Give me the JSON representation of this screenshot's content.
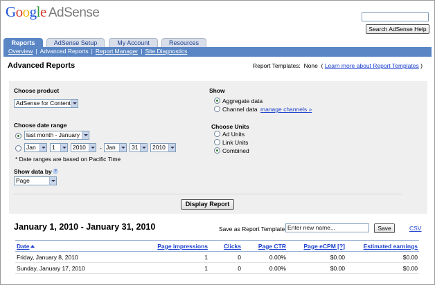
{
  "brand": {
    "google": "Google",
    "product": "AdSense"
  },
  "header": {
    "search_value": "",
    "search_button": "Search AdSense Help"
  },
  "tabs": [
    {
      "label": "Reports",
      "active": true
    },
    {
      "label": "AdSense Setup",
      "active": false
    },
    {
      "label": "My Account",
      "active": false
    },
    {
      "label": "Resources",
      "active": false
    }
  ],
  "subnav": [
    "Overview",
    "Advanced Reports",
    "Report Manager",
    "Site Diagnostics"
  ],
  "page_title": "Advanced Reports",
  "report_templates": {
    "label": "Report Templates:",
    "value": "None",
    "link": "Learn more about Report Templates"
  },
  "options": {
    "choose_product": {
      "label": "Choose product",
      "selected": "AdSense for Content"
    },
    "date_range": {
      "label": "Choose date range",
      "preset": "last month - January",
      "from": {
        "month": "Jan",
        "day": "1",
        "year": "2010"
      },
      "dash": "-",
      "to": {
        "month": "Jan",
        "day": "31",
        "year": "2010"
      },
      "note": "* Date ranges are based on Pacific Time"
    },
    "show_data_by": {
      "label": "Show data by",
      "help": "?",
      "selected": "Page"
    },
    "show": {
      "label": "Show",
      "aggregate": "Aggregate data",
      "channel": "Channel data",
      "manage": "manage channels »",
      "selected": "aggregate"
    },
    "units": {
      "label": "Choose Units",
      "ad": "Ad Units",
      "link": "Link Units",
      "combined": "Combined",
      "selected": "combined"
    },
    "display_button": "Display Report"
  },
  "results": {
    "range_title": "January 1, 2010 - January 31, 2010",
    "save_label": "Save as Report Template:",
    "save_placeholder": "Enter new name...",
    "save_button": "Save",
    "csv": "CSV",
    "columns": [
      "Date",
      "Page impressions",
      "Clicks",
      "Page CTR",
      "Page eCPM [?]",
      "Estimated earnings"
    ],
    "rows": [
      [
        "Friday, January 8, 2010",
        "1",
        "0",
        "0.00%",
        "$0.00",
        "$0.00"
      ],
      [
        "Sunday, January 17, 2010",
        "1",
        "0",
        "0.00%",
        "$0.00",
        "$0.00"
      ]
    ]
  }
}
